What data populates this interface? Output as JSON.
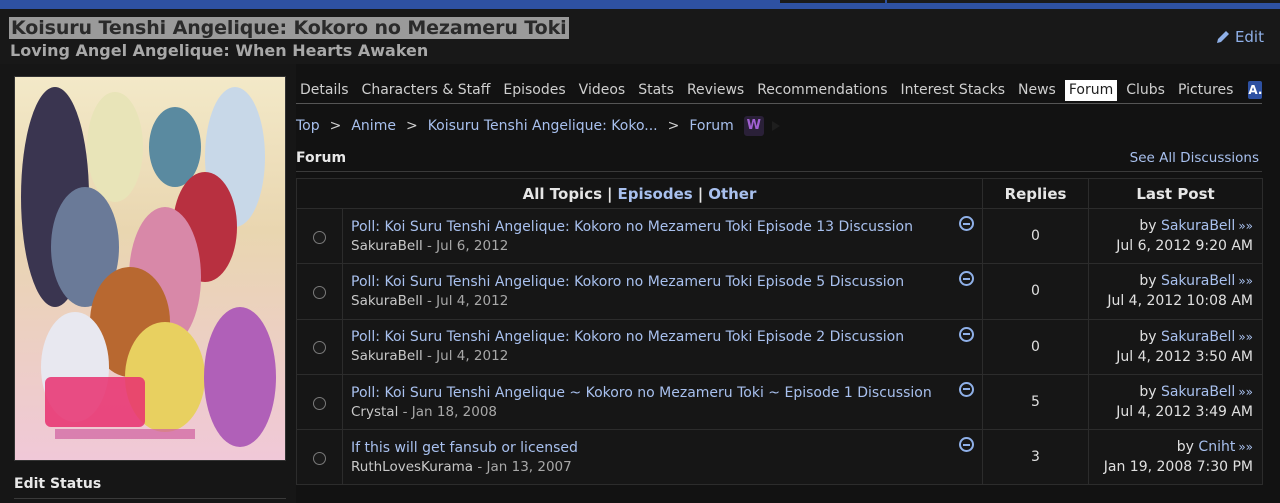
{
  "header": {
    "title": "Koisuru Tenshi Angelique: Kokoro no Mezameru Toki",
    "english_title": "Loving Angel Angelique: When Hearts Awaken",
    "edit_label": "Edit"
  },
  "nav": {
    "tabs": [
      {
        "label": "Details"
      },
      {
        "label": "Characters & Staff"
      },
      {
        "label": "Episodes"
      },
      {
        "label": "Videos"
      },
      {
        "label": "Stats"
      },
      {
        "label": "Reviews"
      },
      {
        "label": "Recommendations"
      },
      {
        "label": "Interest Stacks"
      },
      {
        "label": "News"
      },
      {
        "label": "Forum",
        "active": true
      },
      {
        "label": "Clubs"
      },
      {
        "label": "Pictures"
      }
    ],
    "badge_icon": "mal-a-icon",
    "badge_text": "A."
  },
  "breadcrumb": {
    "items": [
      "Top",
      "Anime",
      "Koisuru Tenshi Angelique: Koko...",
      "Forum"
    ],
    "separator": ">",
    "w_icon_text": "W"
  },
  "forum": {
    "label": "Forum",
    "see_all": "See All Discussions",
    "filters": {
      "all": "All Topics",
      "episodes": "Episodes",
      "other": "Other",
      "separator": "|"
    },
    "col_replies": "Replies",
    "col_last_post": "Last Post",
    "topics": [
      {
        "title": "Poll: Koi Suru Tenshi Angelique: Kokoro no Mezameru Toki Episode 13 Discussion",
        "author": "SakuraBell",
        "date": "Jul 6, 2012",
        "replies": "0",
        "last_by": "SakuraBell",
        "last_date": "Jul 6, 2012 9:20 AM"
      },
      {
        "title": "Poll: Koi Suru Tenshi Angelique: Kokoro no Mezameru Toki Episode 5 Discussion",
        "author": "SakuraBell",
        "date": "Jul 4, 2012",
        "replies": "0",
        "last_by": "SakuraBell",
        "last_date": "Jul 4, 2012 10:08 AM"
      },
      {
        "title": "Poll: Koi Suru Tenshi Angelique: Kokoro no Mezameru Toki Episode 2 Discussion",
        "author": "SakuraBell",
        "date": "Jul 4, 2012",
        "replies": "0",
        "last_by": "SakuraBell",
        "last_date": "Jul 4, 2012 3:50 AM"
      },
      {
        "title": "Poll: Koi Suru Tenshi Angelique ~ Kokoro no Mezameru Toki ~ Episode 1 Discussion",
        "author": "Crystal",
        "date": "Jan 18, 2008",
        "replies": "5",
        "last_by": "SakuraBell",
        "last_date": "Jul 4, 2012 3:49 AM"
      },
      {
        "title": "If this will get fansub or licensed",
        "author": "RuthLovesKurama",
        "date": "Jan 13, 2007",
        "replies": "3",
        "last_by": "Cniht",
        "last_date": "Jan 19, 2008 7:30 PM"
      }
    ],
    "by_prefix": "by",
    "arrows": "»»",
    "meta_sep": "-"
  },
  "sidebar": {
    "edit_status": "Edit Status"
  },
  "colors": {
    "accent": "#2e51a2",
    "link": "#a8c0ee",
    "background": "#121212"
  }
}
